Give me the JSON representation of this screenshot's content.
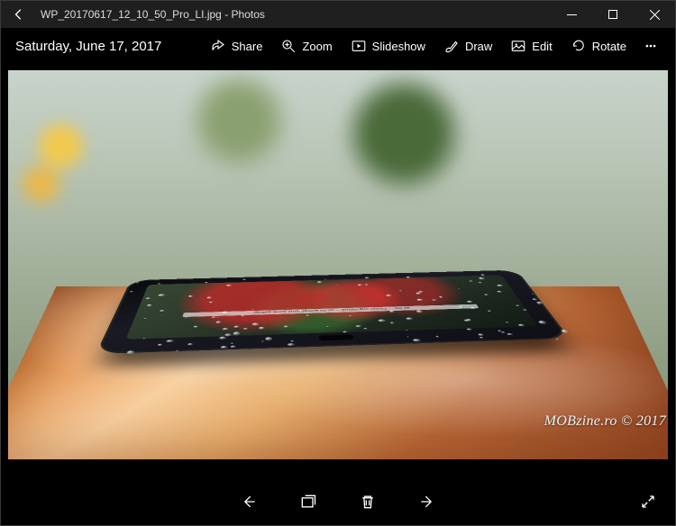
{
  "titlebar": {
    "filename": "WP_20170617_12_10_50_Pro_LI.jpg",
    "appname": "Photos"
  },
  "toolbar": {
    "date": "Saturday, June 17, 2017",
    "share": "Share",
    "zoom": "Zoom",
    "slideshow": "Slideshow",
    "draw": "Draw",
    "edit": "Edit",
    "rotate": "Rotate"
  },
  "photo": {
    "screen_text": "despre acest smartphone cu un ... producător chinez ... sul de"
  },
  "watermark": "MOBzine.ro © 2017"
}
